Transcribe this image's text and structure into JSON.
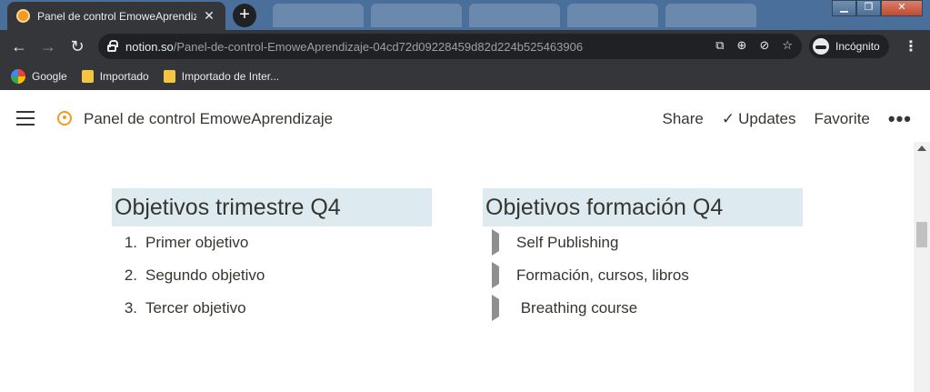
{
  "browser": {
    "active_tab_title": "Panel de control EmoweAprendiz",
    "tab_close": "✕",
    "new_tab": "+",
    "url_host": "notion.so",
    "url_path": "/Panel-de-control-EmoweAprendizaje-04cd72d09228459d82d224b525463906",
    "incognito_label": "Incógnito",
    "bookmarks": [
      {
        "label": "Google",
        "icon": "google-icon"
      },
      {
        "label": "Importado",
        "icon": "folder-icon"
      },
      {
        "label": "Importado de Inter...",
        "icon": "folder-icon"
      }
    ]
  },
  "app": {
    "page_title": "Panel de control EmoweAprendizaje",
    "actions": {
      "share": "Share",
      "updates": "Updates",
      "favorite": "Favorite",
      "more": "•••"
    }
  },
  "content": {
    "left": {
      "heading": "Objetivos trimestre Q4",
      "items": [
        {
          "marker": "1.",
          "text": "Primer objetivo"
        },
        {
          "marker": "2.",
          "text": "Segundo objetivo"
        },
        {
          "marker": "3.",
          "text": "Tercer objetivo"
        }
      ]
    },
    "right": {
      "heading": "Objetivos formación Q4",
      "items": [
        {
          "text": "Self Publishing"
        },
        {
          "text": "Formación, cursos, libros"
        },
        {
          "text": " Breathing course"
        }
      ]
    }
  },
  "colors": {
    "heading_highlight": "#ddebf1",
    "text": "#37352f",
    "chrome_dark": "#35363a",
    "tab_strip": "#4a6f9a"
  }
}
